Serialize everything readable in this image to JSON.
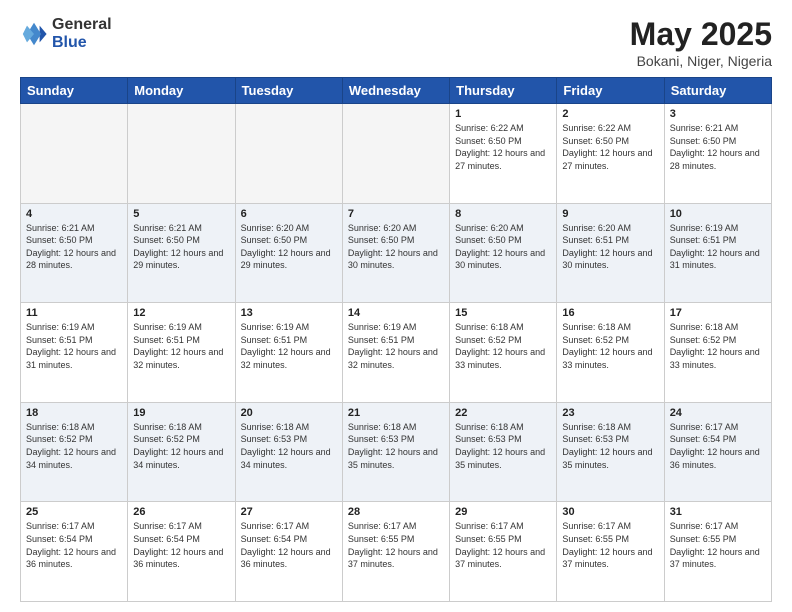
{
  "header": {
    "logo_general": "General",
    "logo_blue": "Blue",
    "title": "May 2025",
    "subtitle": "Bokani, Niger, Nigeria"
  },
  "days_of_week": [
    "Sunday",
    "Monday",
    "Tuesday",
    "Wednesday",
    "Thursday",
    "Friday",
    "Saturday"
  ],
  "weeks": [
    {
      "shade": false,
      "days": [
        {
          "num": "",
          "empty": true
        },
        {
          "num": "",
          "empty": true
        },
        {
          "num": "",
          "empty": true
        },
        {
          "num": "",
          "empty": true
        },
        {
          "num": "1",
          "sunrise": "6:22 AM",
          "sunset": "6:50 PM",
          "daylight": "12 hours and 27 minutes."
        },
        {
          "num": "2",
          "sunrise": "6:22 AM",
          "sunset": "6:50 PM",
          "daylight": "12 hours and 27 minutes."
        },
        {
          "num": "3",
          "sunrise": "6:21 AM",
          "sunset": "6:50 PM",
          "daylight": "12 hours and 28 minutes."
        }
      ]
    },
    {
      "shade": true,
      "days": [
        {
          "num": "4",
          "sunrise": "6:21 AM",
          "sunset": "6:50 PM",
          "daylight": "12 hours and 28 minutes."
        },
        {
          "num": "5",
          "sunrise": "6:21 AM",
          "sunset": "6:50 PM",
          "daylight": "12 hours and 29 minutes."
        },
        {
          "num": "6",
          "sunrise": "6:20 AM",
          "sunset": "6:50 PM",
          "daylight": "12 hours and 29 minutes."
        },
        {
          "num": "7",
          "sunrise": "6:20 AM",
          "sunset": "6:50 PM",
          "daylight": "12 hours and 30 minutes."
        },
        {
          "num": "8",
          "sunrise": "6:20 AM",
          "sunset": "6:50 PM",
          "daylight": "12 hours and 30 minutes."
        },
        {
          "num": "9",
          "sunrise": "6:20 AM",
          "sunset": "6:51 PM",
          "daylight": "12 hours and 30 minutes."
        },
        {
          "num": "10",
          "sunrise": "6:19 AM",
          "sunset": "6:51 PM",
          "daylight": "12 hours and 31 minutes."
        }
      ]
    },
    {
      "shade": false,
      "days": [
        {
          "num": "11",
          "sunrise": "6:19 AM",
          "sunset": "6:51 PM",
          "daylight": "12 hours and 31 minutes."
        },
        {
          "num": "12",
          "sunrise": "6:19 AM",
          "sunset": "6:51 PM",
          "daylight": "12 hours and 32 minutes."
        },
        {
          "num": "13",
          "sunrise": "6:19 AM",
          "sunset": "6:51 PM",
          "daylight": "12 hours and 32 minutes."
        },
        {
          "num": "14",
          "sunrise": "6:19 AM",
          "sunset": "6:51 PM",
          "daylight": "12 hours and 32 minutes."
        },
        {
          "num": "15",
          "sunrise": "6:18 AM",
          "sunset": "6:52 PM",
          "daylight": "12 hours and 33 minutes."
        },
        {
          "num": "16",
          "sunrise": "6:18 AM",
          "sunset": "6:52 PM",
          "daylight": "12 hours and 33 minutes."
        },
        {
          "num": "17",
          "sunrise": "6:18 AM",
          "sunset": "6:52 PM",
          "daylight": "12 hours and 33 minutes."
        }
      ]
    },
    {
      "shade": true,
      "days": [
        {
          "num": "18",
          "sunrise": "6:18 AM",
          "sunset": "6:52 PM",
          "daylight": "12 hours and 34 minutes."
        },
        {
          "num": "19",
          "sunrise": "6:18 AM",
          "sunset": "6:52 PM",
          "daylight": "12 hours and 34 minutes."
        },
        {
          "num": "20",
          "sunrise": "6:18 AM",
          "sunset": "6:53 PM",
          "daylight": "12 hours and 34 minutes."
        },
        {
          "num": "21",
          "sunrise": "6:18 AM",
          "sunset": "6:53 PM",
          "daylight": "12 hours and 35 minutes."
        },
        {
          "num": "22",
          "sunrise": "6:18 AM",
          "sunset": "6:53 PM",
          "daylight": "12 hours and 35 minutes."
        },
        {
          "num": "23",
          "sunrise": "6:18 AM",
          "sunset": "6:53 PM",
          "daylight": "12 hours and 35 minutes."
        },
        {
          "num": "24",
          "sunrise": "6:17 AM",
          "sunset": "6:54 PM",
          "daylight": "12 hours and 36 minutes."
        }
      ]
    },
    {
      "shade": false,
      "days": [
        {
          "num": "25",
          "sunrise": "6:17 AM",
          "sunset": "6:54 PM",
          "daylight": "12 hours and 36 minutes."
        },
        {
          "num": "26",
          "sunrise": "6:17 AM",
          "sunset": "6:54 PM",
          "daylight": "12 hours and 36 minutes."
        },
        {
          "num": "27",
          "sunrise": "6:17 AM",
          "sunset": "6:54 PM",
          "daylight": "12 hours and 36 minutes."
        },
        {
          "num": "28",
          "sunrise": "6:17 AM",
          "sunset": "6:55 PM",
          "daylight": "12 hours and 37 minutes."
        },
        {
          "num": "29",
          "sunrise": "6:17 AM",
          "sunset": "6:55 PM",
          "daylight": "12 hours and 37 minutes."
        },
        {
          "num": "30",
          "sunrise": "6:17 AM",
          "sunset": "6:55 PM",
          "daylight": "12 hours and 37 minutes."
        },
        {
          "num": "31",
          "sunrise": "6:17 AM",
          "sunset": "6:55 PM",
          "daylight": "12 hours and 37 minutes."
        }
      ]
    }
  ]
}
